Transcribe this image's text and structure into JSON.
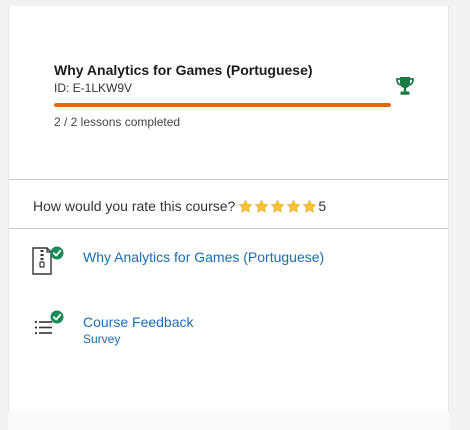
{
  "course": {
    "title": "Why Analytics for Games (Portuguese)",
    "id_text": "ID: E-1LKW9V",
    "progress_fraction": 1.0,
    "lessons_completed_text": "2 / 2 lessons completed",
    "progress_color": "#dd6a13",
    "trophy_icon": "trophy-icon",
    "trophy_color": "#1b7a44"
  },
  "rating": {
    "prompt": "How would you rate this course?",
    "stars": 5,
    "value_text": "5",
    "star_color": "#f6c234"
  },
  "items": [
    {
      "title": "Why Analytics for Games (Portuguese)",
      "subtitle": "",
      "icon": "zip-file-icon",
      "status_icon": "check-circle-icon"
    },
    {
      "title": "Course Feedback",
      "subtitle": "Survey",
      "icon": "survey-list-icon",
      "status_icon": "check-circle-icon"
    }
  ],
  "colors": {
    "link": "#1a6db2",
    "check": "#1b8a5a"
  }
}
